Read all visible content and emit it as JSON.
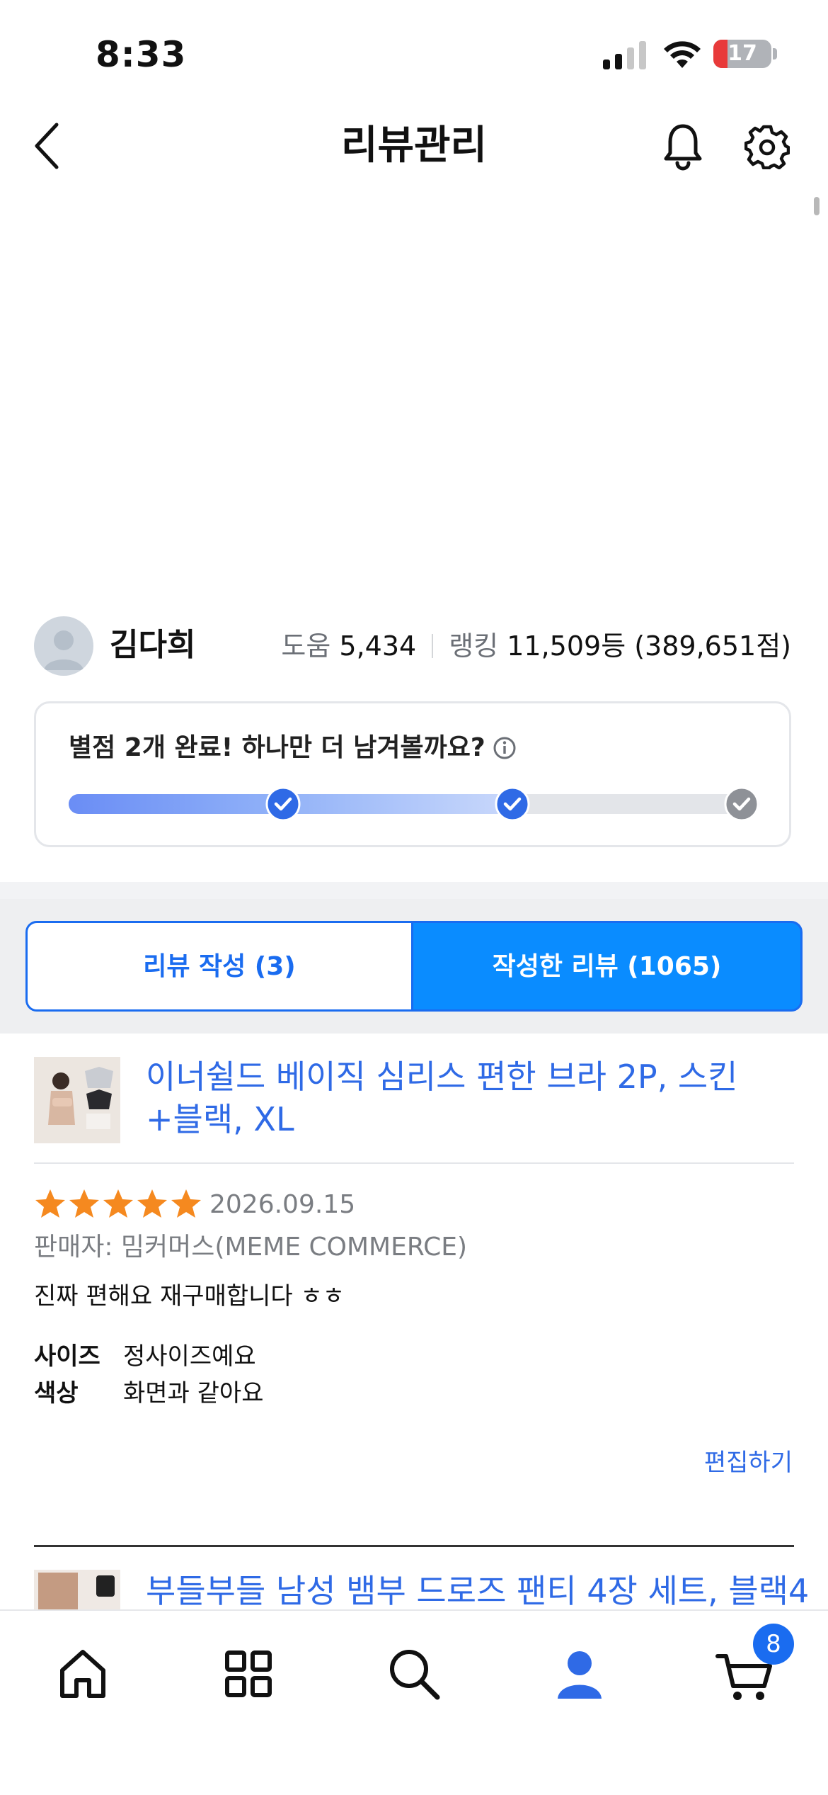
{
  "status_bar": {
    "time": "8:33",
    "battery": "17"
  },
  "header": {
    "title": "리뷰관리"
  },
  "profile": {
    "name": "김다희",
    "help_label": "도움",
    "help_value": "5,434",
    "ranking_label": "랭킹",
    "ranking_value": "11,509등 (389,651점)"
  },
  "progress_card": {
    "message": "별점 2개 완료! 하나만 더 남겨볼까요?",
    "completed_steps": 2,
    "total_steps": 3
  },
  "tabs": [
    {
      "label": "리뷰 작성 (3)",
      "active": false
    },
    {
      "label": "작성한 리뷰 (1065)",
      "active": true
    }
  ],
  "reviews": [
    {
      "product_title": "이너쉴드 베이직 심리스 편한 브라 2P, 스킨+블랙, XL",
      "rating": 5,
      "date": "2026.09.15",
      "seller": "판매자: 밈커머스(MEME COMMERCE)",
      "text": "진짜 편해요 재구매합니다 ㅎㅎ",
      "attributes": [
        {
          "key": "사이즈",
          "value": "정사이즈예요"
        },
        {
          "key": "색상",
          "value": "화면과 같아요"
        }
      ],
      "edit_label": "편집하기"
    },
    {
      "product_title": "부들부들 남성 뱀부 드로즈 팬티 4장 세트, 블랙4"
    }
  ],
  "bottom_nav": {
    "items": [
      "home-icon",
      "categories-icon",
      "search-icon",
      "my-page-icon",
      "cart-icon"
    ],
    "cart_badge": "8",
    "active_color": "#2f6ae6"
  },
  "colors": {
    "accent": "#0a8cff",
    "link": "#2f6ae6",
    "star": "#f5891f"
  }
}
